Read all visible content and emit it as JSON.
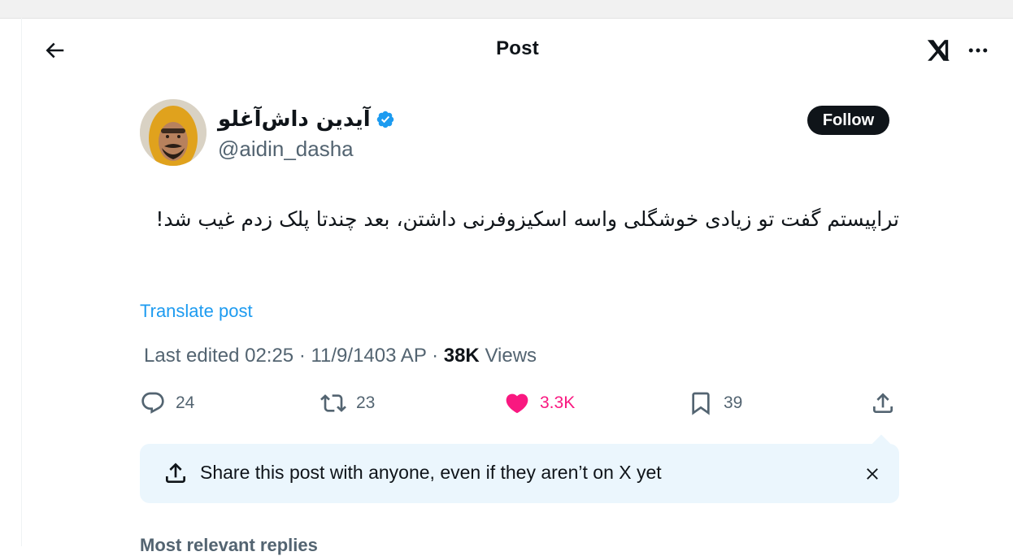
{
  "header": {
    "title": "Post",
    "back_icon": "arrow-left-icon",
    "logo_icon": "x-logo-icon",
    "more_icon": "more-horizontal-icon"
  },
  "author": {
    "display_name": "آیدین داش‌آغلو",
    "handle": "@aidin_dasha",
    "verified_icon": "verified-badge-icon",
    "follow_label": "Follow"
  },
  "tweet": {
    "text": "تراپیستم گفت تو زیادی خوشگلی واسه اسکیزوفرنی داشتن، بعد چندتا پلک زدم غیب شد!",
    "translate_label": "Translate post",
    "edited_label": "Last edited 02:25 · 11/9/1403 AP",
    "views_count": "38K",
    "views_label": "Views"
  },
  "actions": {
    "reply_count": "24",
    "repost_count": "23",
    "like_count": "3.3K",
    "bookmark_count": "39",
    "like_color": "#f91880"
  },
  "share_tip": {
    "text": "Share this post with anyone, even if they aren’t on X yet"
  },
  "replies": {
    "label": "Most relevant replies"
  }
}
